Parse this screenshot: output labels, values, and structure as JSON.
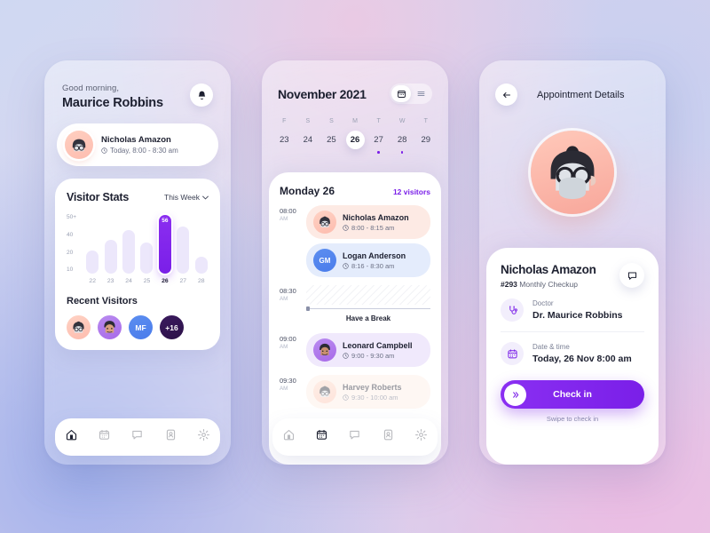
{
  "phone1": {
    "greeting": "Good morning,",
    "user_name": "Maurice Robbins",
    "bell_icon": "bell-icon",
    "appointment": {
      "name": "Nicholas Amazon",
      "time": "Today, 8:00 - 8:30 am",
      "clock_icon": "clock-icon"
    },
    "stats": {
      "title": "Visitor Stats",
      "range_label": "This Week",
      "chevron_icon": "chevron-down-icon"
    },
    "recent": {
      "title": "Recent Visitors",
      "avatars": [
        {
          "label": "",
          "style": "a"
        },
        {
          "label": "",
          "style": "b"
        },
        {
          "label": "MF",
          "style": "c"
        },
        {
          "label": "+16",
          "style": "d"
        }
      ]
    },
    "tabs": [
      {
        "name": "tab-home",
        "icon": "home-icon",
        "active": true
      },
      {
        "name": "tab-calendar",
        "icon": "calendar-icon",
        "active": false
      },
      {
        "name": "tab-chat",
        "icon": "chat-icon",
        "active": false
      },
      {
        "name": "tab-contacts",
        "icon": "id-card-icon",
        "active": false
      },
      {
        "name": "tab-settings",
        "icon": "gear-icon",
        "active": false
      }
    ]
  },
  "phone2": {
    "month": "November 2021",
    "view_toggle": [
      {
        "name": "view-calendar",
        "icon": "calendar-icon",
        "active": true
      },
      {
        "name": "view-list",
        "icon": "list-icon",
        "active": false
      }
    ],
    "week": [
      {
        "letter": "F",
        "date": "23",
        "selected": false,
        "dot": false
      },
      {
        "letter": "S",
        "date": "24",
        "selected": false,
        "dot": false
      },
      {
        "letter": "S",
        "date": "25",
        "selected": false,
        "dot": false
      },
      {
        "letter": "M",
        "date": "26",
        "selected": true,
        "dot": false
      },
      {
        "letter": "T",
        "date": "27",
        "selected": false,
        "dot": true
      },
      {
        "letter": "W",
        "date": "28",
        "selected": false,
        "dot": true
      },
      {
        "letter": "T",
        "date": "29",
        "selected": false,
        "dot": false
      }
    ],
    "schedule": {
      "day_label": "Monday 26",
      "visitor_count": "12 visitors",
      "slots": [
        {
          "hour": "08:00",
          "meridiem": "AM",
          "events": [
            {
              "name": "Nicholas Amazon",
              "time": "8:00 - 8:15 am",
              "initials": "",
              "tone": "peach",
              "avatar": "photo"
            },
            {
              "name": "Logan Anderson",
              "time": "8:16 - 8:30 am",
              "initials": "GM",
              "tone": "blue",
              "avatar": "initials"
            }
          ]
        },
        {
          "hour": "08:30",
          "meridiem": "AM",
          "break_label": "Have a Break",
          "events": []
        },
        {
          "hour": "09:00",
          "meridiem": "AM",
          "events": [
            {
              "name": "Leonard Campbell",
              "time": "9:00 - 9:30 am",
              "initials": "",
              "tone": "lilac",
              "avatar": "photo"
            }
          ]
        },
        {
          "hour": "09:30",
          "meridiem": "AM",
          "events": [
            {
              "name": "Harvey Roberts",
              "time": "9:30 - 10:00 am",
              "initials": "",
              "tone": "fade",
              "avatar": "photo"
            }
          ]
        }
      ]
    },
    "tabs": [
      {
        "name": "tab-home",
        "icon": "home-icon",
        "active": false
      },
      {
        "name": "tab-calendar",
        "icon": "calendar-icon",
        "active": true
      },
      {
        "name": "tab-chat",
        "icon": "chat-icon",
        "active": false
      },
      {
        "name": "tab-contacts",
        "icon": "id-card-icon",
        "active": false
      },
      {
        "name": "tab-settings",
        "icon": "gear-icon",
        "active": false
      }
    ]
  },
  "phone3": {
    "back_icon": "arrow-left-icon",
    "title": "Appointment Details",
    "patient_name": "Nicholas Amazon",
    "patient_id": "#293",
    "visit_type": "Monthly Checkup",
    "chat_icon": "chat-icon",
    "rows": [
      {
        "label": "Doctor",
        "value": "Dr. Maurice Robbins",
        "icon": "stethoscope-icon"
      },
      {
        "label": "Date & time",
        "value": "Today, 26 Nov 8:00 am",
        "icon": "calendar-icon"
      }
    ],
    "cta_label": "Check in",
    "cta_hint": "Swipe to check in",
    "cta_knob_icon": "double-chevron-right-icon"
  },
  "colors": {
    "accent": "#7a1fe8",
    "accent_light": "#ece7fb",
    "text_dark": "#1d2030",
    "text_muted": "#9aa0b3",
    "peach": "#fdeae4",
    "blue": "#e4ecfc",
    "lilac": "#f0e9fc"
  },
  "chart_data": {
    "type": "bar",
    "title": "Visitor Stats",
    "subtitle": "This Week",
    "xlabel": "",
    "ylabel": "",
    "categories": [
      "22",
      "23",
      "24",
      "25",
      "26",
      "27",
      "28"
    ],
    "values": [
      22,
      32,
      42,
      30,
      56,
      45,
      16
    ],
    "highlight_index": 4,
    "highlight_value": 56,
    "value_labels": [
      "",
      "",
      "",
      "",
      "56",
      "",
      ""
    ],
    "ytick_labels": [
      "50+",
      "40",
      "20",
      "10"
    ],
    "ylim": [
      0,
      56
    ],
    "grid": false,
    "legend": false,
    "bar_color": "#ece7fb",
    "highlight_color": "#7a1fe8"
  }
}
